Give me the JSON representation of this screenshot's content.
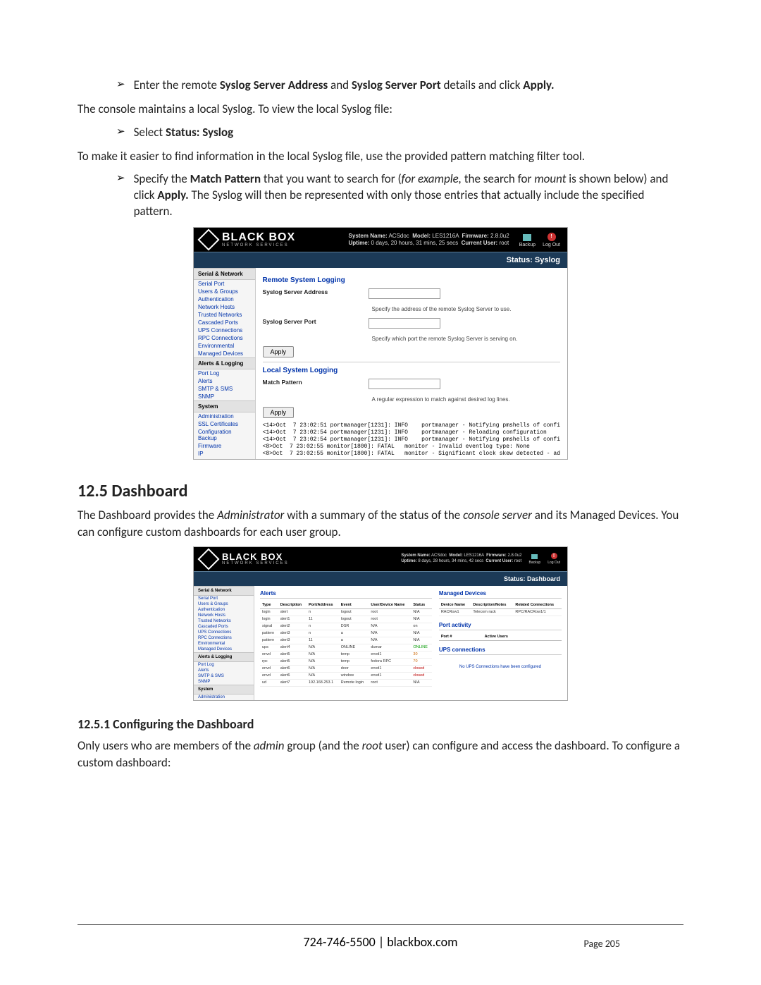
{
  "doc": {
    "bul1_pre": "Enter the remote ",
    "bul1_b1": "Syslog Server Address",
    "bul1_mid": " and ",
    "bul1_b2": "Syslog Server Port",
    "bul1_post": " details and click ",
    "bul1_b3": "Apply.",
    "p1": "The console maintains a local Syslog. To view the local Syslog file:",
    "bul2_pre": "Select ",
    "bul2_b": "Status: Syslog",
    "p2": "To make it easier to find information in the local Syslog file, use the provided pattern matching filter tool.",
    "bul3_pre": "Specify the ",
    "bul3_b1": "Match Pattern",
    "bul3_mid1": " that you want to search for (",
    "bul3_i": "for example,",
    "bul3_mid2": " the search for ",
    "bul3_i2": "mount",
    "bul3_mid3": " is shown below) and click ",
    "bul3_b2": "Apply.",
    "bul3_post": " The Syslog will then be represented with only those entries that actually include the specified pattern.",
    "h2": "12.5   Dashboard",
    "p3a": "The Dashboard provides the ",
    "p3i1": "Administrator",
    "p3b": " with a summary of the status of the ",
    "p3i2": "console server",
    "p3c": " and its Managed Devices. You can configure custom dashboards for each user group.",
    "h3": "12.5.1  Configuring the Dashboard",
    "p4a": "Only users who are members of the ",
    "p4i1": "admin",
    "p4b": " group (and the ",
    "p4i2": "root",
    "p4c": " user) can configure and access the dashboard. To configure a custom dashboard:",
    "footer": "724-746-5500 | blackbox.com",
    "pageno": "Page 205"
  },
  "app1": {
    "brand": "BLACK BOX",
    "brand_sub": "NETWORK SERVICES",
    "sys_line1_labels": {
      "sysname": "System Name:",
      "model": "Model:",
      "fw": "Firmware:"
    },
    "sys_line1_vals": {
      "sysname": "ACSdoc",
      "model": "LES1216A",
      "fw": "2.8.0u2"
    },
    "sys_line2_labels": {
      "uptime": "Uptime:",
      "user": "Current User:"
    },
    "sys_line2_vals": {
      "uptime": "0 days, 20 hours, 31 mins, 25 secs",
      "user": "root"
    },
    "icons": {
      "backup": "Backup",
      "logout": "Log Out"
    },
    "title": "Status: Syslog",
    "sidebar": {
      "g1": "Serial & Network",
      "g1_items": [
        "Serial Port",
        "Users & Groups",
        "Authentication",
        "Network Hosts",
        "Trusted Networks",
        "Cascaded Ports",
        "UPS Connections",
        "RPC Connections",
        "Environmental",
        "Managed Devices"
      ],
      "g2": "Alerts & Logging",
      "g2_items": [
        "Port Log",
        "Alerts",
        "SMTP & SMS",
        "SNMP"
      ],
      "g3": "System",
      "g3_items": [
        "Administration",
        "SSL Certificates",
        "Configuration Backup",
        "Firmware",
        "IP"
      ]
    },
    "sec1": "Remote System Logging",
    "row1_label": "Syslog Server Address",
    "row1_help": "Specify the address of the remote Syslog Server to use.",
    "row2_label": "Syslog Server Port",
    "row2_help": "Specify which port the remote Syslog Server is serving on.",
    "apply": "Apply",
    "sec2": "Local System Logging",
    "row3_label": "Match Pattern",
    "row3_help": "A regular expression to match against desired log lines.",
    "log": "<14>Oct  7 23:02:51 portmanager[1231]: INFO    portmanager - Notifying pmshells of confi\n<14>Oct  7 23:02:54 portmanager[1231]: INFO    portmanager - Reloading configuration\n<14>Oct  7 23:02:54 portmanager[1231]: INFO    portmanager - Notifying pmshells of confi\n<8>Oct  7 23:02:55 monitor[1800]: FATAL   monitor - Invalid eventlog type: None\n<8>Oct  7 23:02:55 monitor[1800]: FATAL   monitor - Significant clock skew detected - ad"
  },
  "app2": {
    "brand": "BLACK BOX",
    "brand_sub": "NETWORK SERVICES",
    "sys_line1_vals": {
      "sysname": "ACSdoc",
      "model": "LES1216A",
      "fw": "2.8.0u2"
    },
    "sys_line2_vals": {
      "uptime": "8 days, 28 hours, 34 mins, 42 secs",
      "user": "root"
    },
    "icons": {
      "backup": "Backup",
      "logout": "Log Out"
    },
    "title": "Status: Dashboard",
    "sidebar": {
      "g1": "Serial & Network",
      "g1_items": [
        "Serial Port",
        "Users & Groups",
        "Authentication",
        "Network Hosts",
        "Trusted Networks",
        "Cascaded Ports",
        "UPS Connections",
        "RPC Connections",
        "Environmental",
        "Managed Devices"
      ],
      "g2": "Alerts & Logging",
      "g2_items": [
        "Port Log",
        "Alerts",
        "SMTP & SMS",
        "SNMP"
      ],
      "g3": "System",
      "g3_items": [
        "Administration"
      ]
    },
    "alerts_h": "Alerts",
    "alerts_cols": [
      "Type",
      "Description",
      "Port/Address",
      "Event",
      "User/Device Name",
      "Status"
    ],
    "alerts_rows": [
      [
        "login",
        "alert",
        "n",
        "logout",
        "root",
        "N/A"
      ],
      [
        "login",
        "alert1",
        "11",
        "logout",
        "root",
        "N/A"
      ],
      [
        "signal",
        "alert2",
        "n",
        "DSR",
        "N/A",
        "on"
      ],
      [
        "pattern",
        "alert3",
        "n",
        "a",
        "N/A",
        "N/A"
      ],
      [
        "pattern",
        "alert3",
        "11",
        "a",
        "N/A",
        "N/A"
      ],
      [
        "ups",
        "alert4",
        "N/A",
        "ONLINE",
        "dumar",
        "ONLINE"
      ],
      [
        "envd",
        "alert5",
        "N/A",
        "temp",
        "envd1",
        "30"
      ],
      [
        "rpc",
        "alert5",
        "N/A",
        "temp",
        "fedora RPC",
        "70"
      ],
      [
        "envd",
        "alert6",
        "N/A",
        "door",
        "envd1",
        "closed"
      ],
      [
        "envd",
        "alert6",
        "N/A",
        "window",
        "envd1",
        "closed"
      ],
      [
        "ud",
        "alert7",
        "192.168.253.1",
        "Remote login",
        "root",
        "N/A"
      ]
    ],
    "md_h": "Managed Devices",
    "md_cols": [
      "Device Name",
      "Description/Notes",
      "Related Connections"
    ],
    "md_rows": [
      [
        "RACRow1",
        "Telecom rack",
        "RPC/RACRow1/1"
      ]
    ],
    "pa_h": "Port activity",
    "pa_cols": [
      "Port #",
      "Active Users"
    ],
    "ups_h": "UPS connections",
    "ups_empty": "No UPS Connections have been configured"
  }
}
